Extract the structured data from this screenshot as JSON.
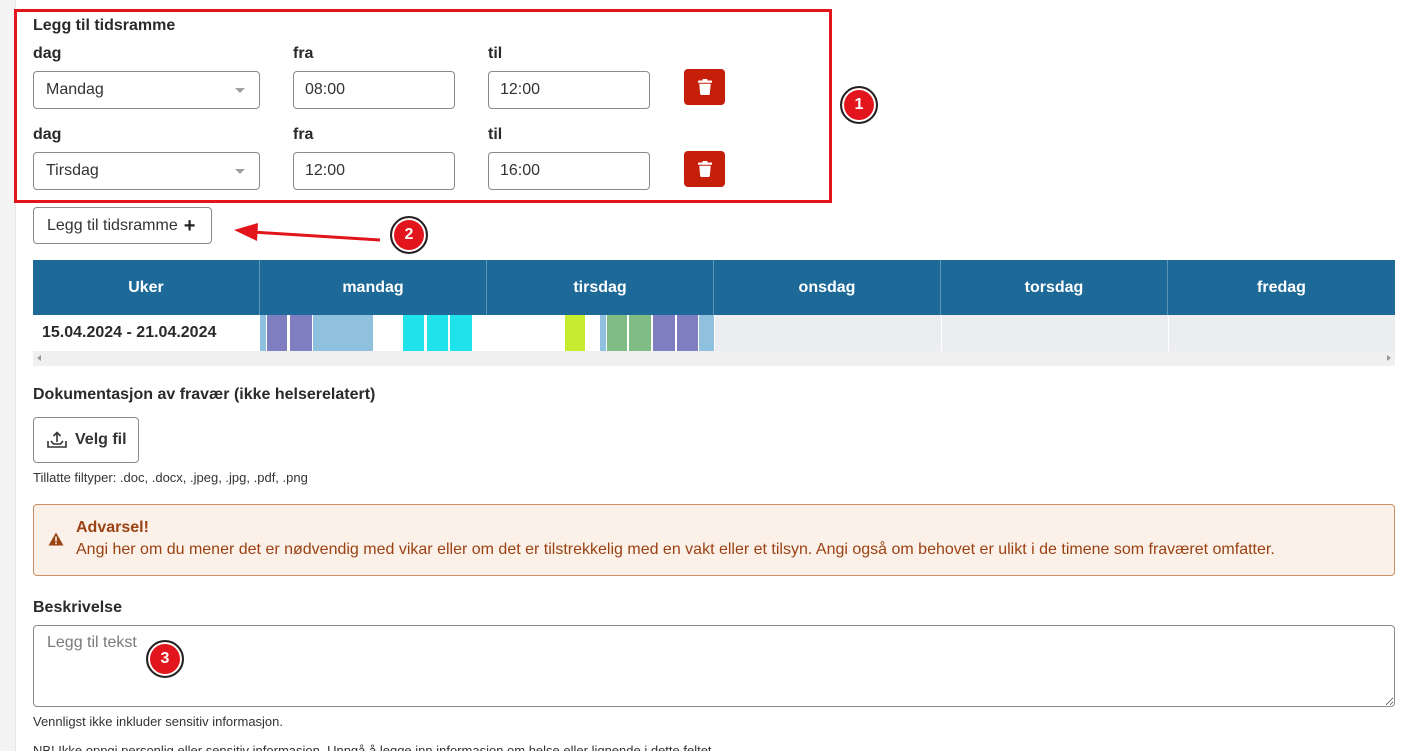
{
  "timeframe": {
    "title": "Legg til tidsramme",
    "rows": [
      {
        "day_label": "dag",
        "from_label": "fra",
        "to_label": "til",
        "day": "Mandag",
        "from": "08:00",
        "to": "12:00"
      },
      {
        "day_label": "dag",
        "from_label": "fra",
        "to_label": "til",
        "day": "Tirsdag",
        "from": "12:00",
        "to": "16:00"
      }
    ],
    "add_button": "Legg til tidsramme"
  },
  "annotations": {
    "one": "1",
    "two": "2",
    "three": "3"
  },
  "week_table": {
    "headers": [
      "Uker",
      "mandag",
      "tirsdag",
      "onsdag",
      "torsdag",
      "fredag"
    ],
    "row": {
      "week": "15.04.2024 - 21.04.2024"
    }
  },
  "documentation": {
    "title": "Dokumentasjon av fravær (ikke helserelatert)",
    "file_button": "Velg fil",
    "allowed_types": "Tillatte filtyper: .doc, .docx, .jpeg, .jpg, .pdf, .png"
  },
  "alert": {
    "title": "Advarsel!",
    "text": "Angi her om du mener det er nødvendig med vikar eller om det er tilstrekkelig med en vakt eller et tilsyn. Angi også om behovet er ulikt i de timene som fraværet omfatter."
  },
  "description": {
    "title": "Beskrivelse",
    "placeholder": "Legg til tekst",
    "hint": "Vennligst ikke inkluder sensitiv informasjon.",
    "note": "NB! Ikke oppgi personlig eller sensitiv informasjon. Unngå å legge inn informasjon om helse eller lignende i dette feltet."
  },
  "colors": {
    "highlight": "#e3151c",
    "header_bg": "#1d6a99",
    "delete_btn": "#c51f0a",
    "alert_text": "#9a4214",
    "alert_bg": "#fcf1e8"
  }
}
